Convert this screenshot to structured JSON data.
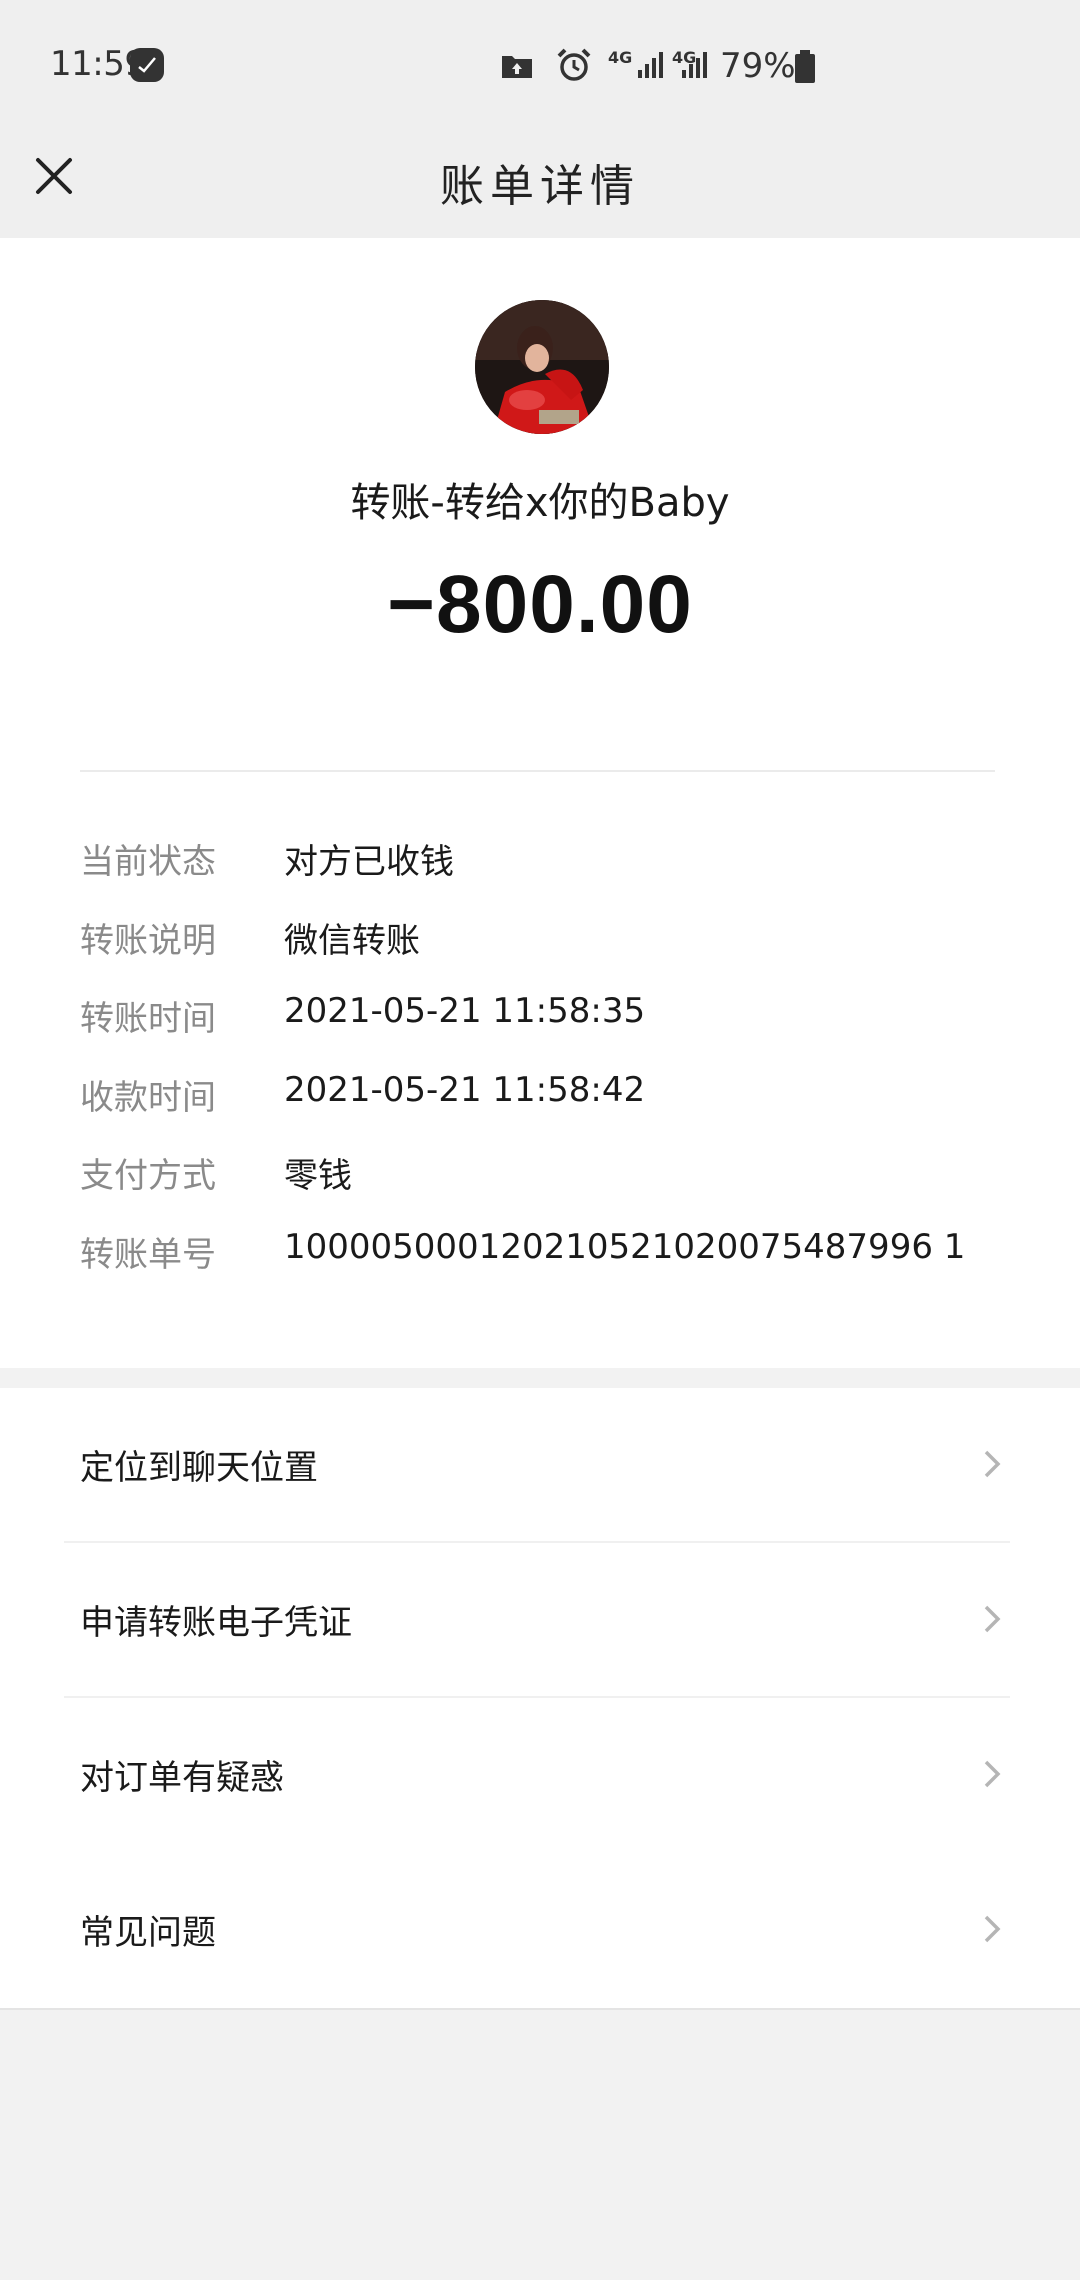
{
  "status_bar": {
    "time": "11:59",
    "battery": "79%",
    "network_1": "4G",
    "network_2": "4G"
  },
  "nav": {
    "title": "账单详情"
  },
  "transfer": {
    "payee": "转账-转给x你的Baby",
    "amount": "−800.00"
  },
  "details": [
    {
      "label": "当前状态",
      "value": "对方已收钱"
    },
    {
      "label": "转账说明",
      "value": "微信转账"
    },
    {
      "label": "转账时间",
      "value": "2021-05-21 11:58:35"
    },
    {
      "label": "收款时间",
      "value": "2021-05-21 11:58:42"
    },
    {
      "label": "支付方式",
      "value": "零钱"
    },
    {
      "label": "转账单号",
      "value": "100005000120210521020075487996 1"
    }
  ],
  "menu": [
    {
      "label": "定位到聊天位置"
    },
    {
      "label": "申请转账电子凭证"
    },
    {
      "label": "对订单有疑惑"
    },
    {
      "label": "常见问题"
    }
  ],
  "colors": {
    "background": "#f2f2f2",
    "card": "#ffffff",
    "label_gray": "#8a8a8a"
  }
}
